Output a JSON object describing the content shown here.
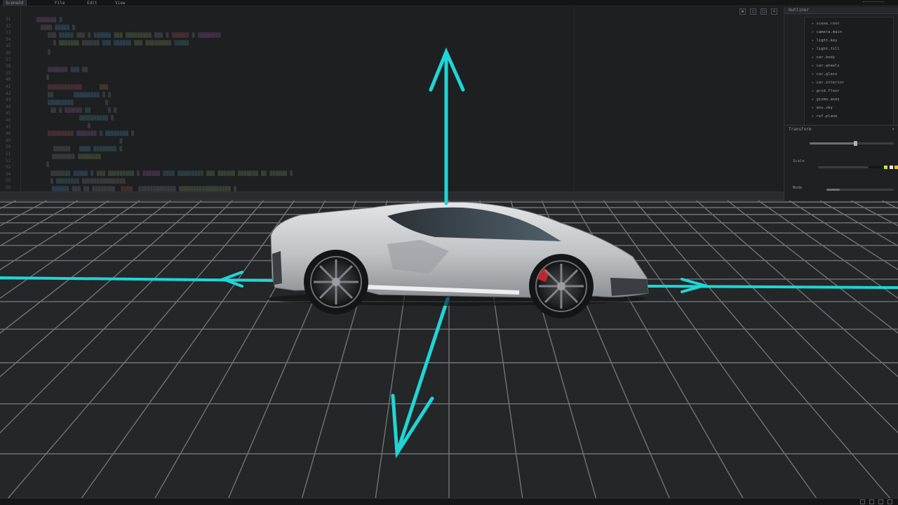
{
  "topbar": {
    "tabs": [
      {
        "label": "Scene3d"
      },
      {
        "label": "File"
      },
      {
        "label": "Edit"
      },
      {
        "label": "View"
      }
    ]
  },
  "editor": {
    "toolbar_icons": [
      "pin-icon",
      "split-icon",
      "maximize-icon",
      "close-icon"
    ],
    "line_numbers": [
      "31",
      "32",
      "33",
      "34",
      "35",
      "36",
      "37",
      "38",
      "39",
      "40",
      "41",
      "42",
      "43",
      "44",
      "45",
      "46",
      "47",
      "48",
      "49",
      "50",
      "51",
      "52",
      "53",
      "54",
      "55",
      "56"
    ]
  },
  "sidepanel": {
    "header": "Outliner",
    "tree_items": [
      "scene.root",
      "camera.main",
      "light.key",
      "light.fill",
      "car.body",
      "car.wheels",
      "car.glass",
      "car.interior",
      "grid.floor",
      "gizmo.axes",
      "env.sky",
      "ref.plane"
    ],
    "props_title": "Transform",
    "props_label_a": "Scale",
    "props_label_b": "Mode",
    "slider_value_a": 0.55,
    "slider_value_b": 0.8
  },
  "viewport": {
    "gizmo_color": "#1fd6d6",
    "grid_color": "#8a8f94",
    "car_body_color": "#c9cccf"
  },
  "statusbar": {
    "icons": [
      "layout-icon",
      "settings-icon",
      "bell-icon",
      "user-icon"
    ]
  }
}
